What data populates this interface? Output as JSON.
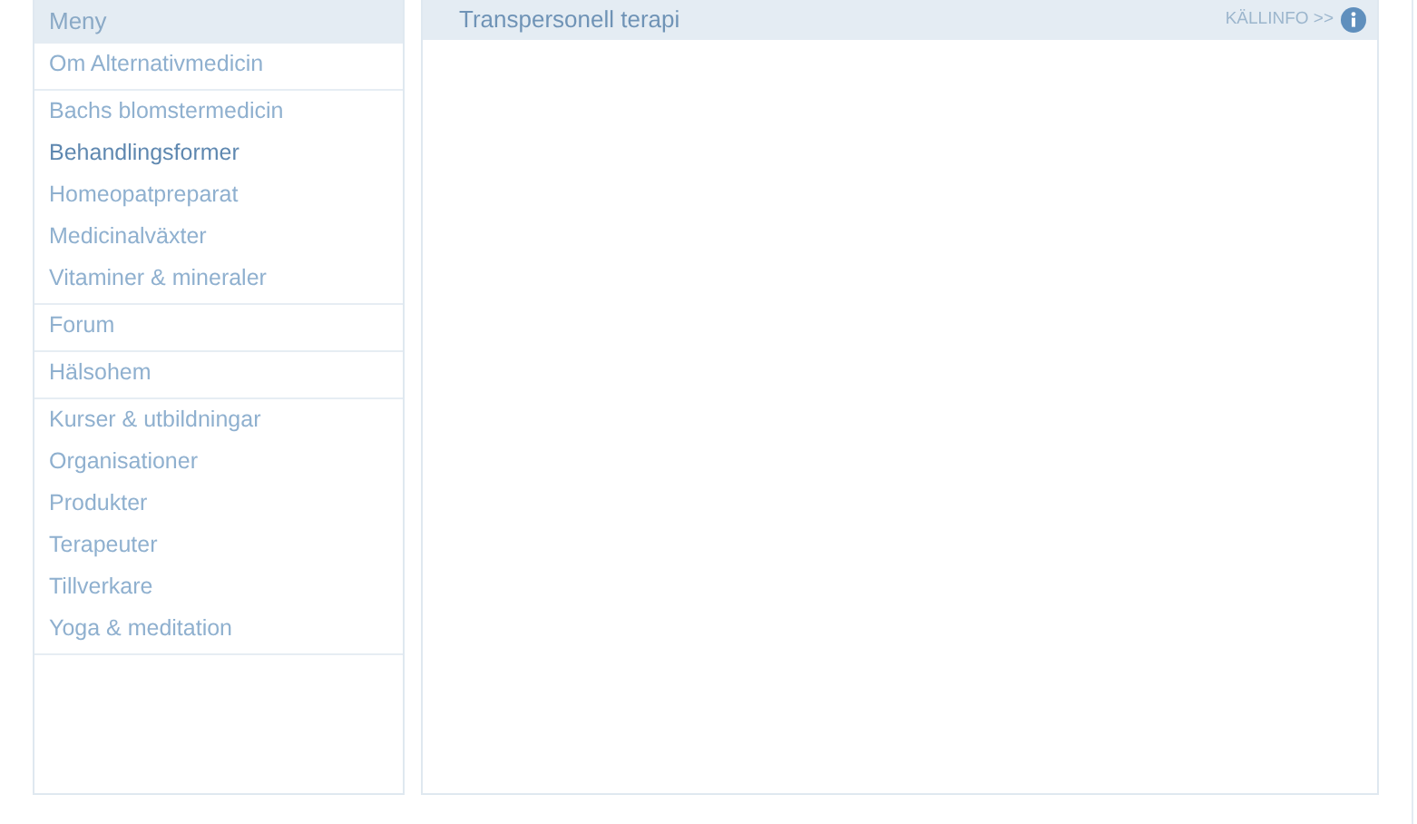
{
  "menu": {
    "title": "Meny",
    "groups": [
      {
        "items": [
          {
            "label": "Om Alternativmedicin",
            "selected": false
          }
        ]
      },
      {
        "items": [
          {
            "label": "Bachs blomstermedicin",
            "selected": false
          },
          {
            "label": "Behandlingsformer",
            "selected": true
          },
          {
            "label": "Homeopatpreparat",
            "selected": false
          },
          {
            "label": "Medicinalväxter",
            "selected": false
          },
          {
            "label": "Vitaminer & mineraler",
            "selected": false
          }
        ]
      },
      {
        "items": [
          {
            "label": "Forum",
            "selected": false
          }
        ]
      },
      {
        "items": [
          {
            "label": "Hälsohem",
            "selected": false
          }
        ]
      },
      {
        "items": [
          {
            "label": "Kurser & utbildningar",
            "selected": false
          },
          {
            "label": "Organisationer",
            "selected": false
          },
          {
            "label": "Produkter",
            "selected": false
          },
          {
            "label": "Terapeuter",
            "selected": false
          },
          {
            "label": "Tillverkare",
            "selected": false
          },
          {
            "label": "Yoga & meditation",
            "selected": false
          }
        ]
      }
    ]
  },
  "content": {
    "title": "Transpersonell terapi",
    "source_link": "KÄLLINFO >>"
  }
}
